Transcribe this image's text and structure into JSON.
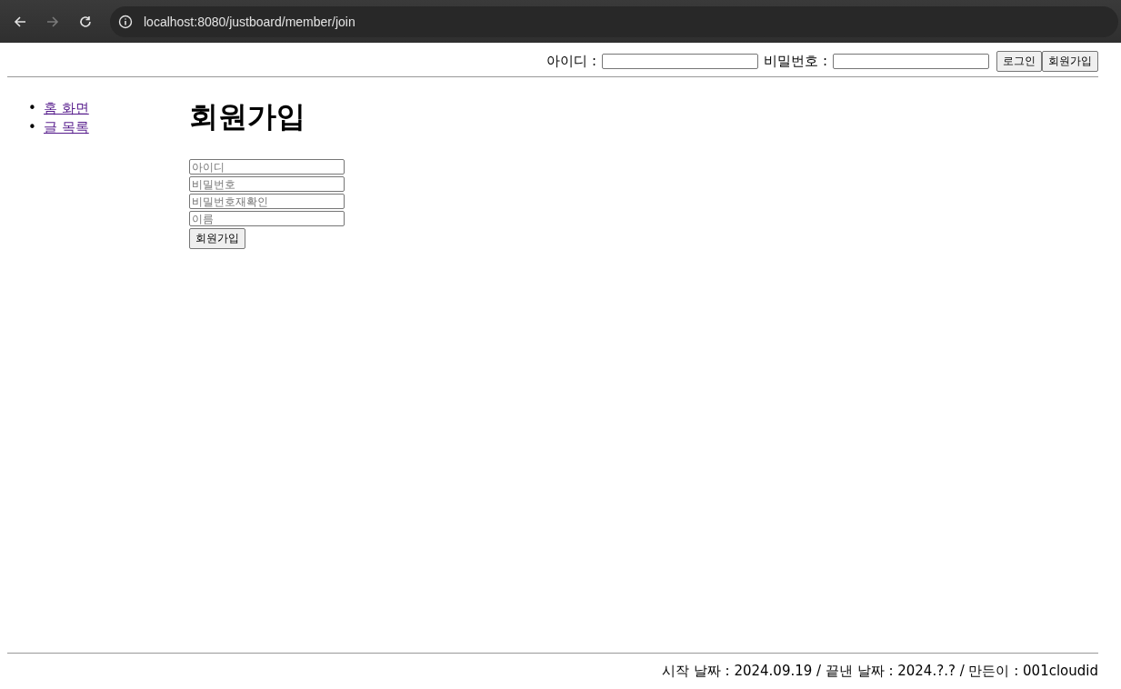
{
  "browser": {
    "url": "localhost:8080/justboard/member/join"
  },
  "login_bar": {
    "id_label": "아이디 :",
    "password_label": "비밀번호 :",
    "buttons": [
      "로그인",
      "회원가입"
    ]
  },
  "nav": [
    {
      "marker": "•",
      "label": "홈 화면",
      "visited": true
    },
    {
      "marker": "•",
      "label": "글 목록",
      "visited": true
    }
  ],
  "title": "회원가입",
  "form": {
    "fields": [
      {
        "placeholder": "아이디"
      },
      {
        "placeholder": "비밀번호"
      },
      {
        "placeholder": "비밀번호재확인"
      },
      {
        "placeholder": "이름"
      }
    ],
    "submit": "회원가입"
  },
  "footer": "시작 날짜 : 2024.09.19 / 끝낸 날짜 : 2024.?.? / 만든이 : 001cloudid"
}
